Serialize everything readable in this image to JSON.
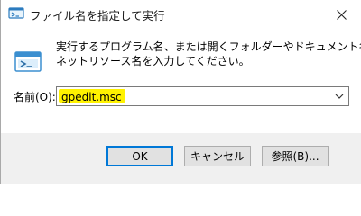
{
  "window": {
    "title": "ファイル名を指定して実行"
  },
  "dialog": {
    "description_line1": "実行するプログラム名、または開くフォルダーやドキュメント名、インター",
    "description_line2": "ネットリソース名を入力してください。",
    "open_label": "名前(O):",
    "open_value": "gpedit.msc"
  },
  "buttons": {
    "ok": "OK",
    "cancel": "キャンセル",
    "browse": "参照(B)..."
  },
  "colors": {
    "highlight": "#fff200",
    "accent": "#0078d7"
  },
  "icons": {
    "title": "run-app-icon",
    "close": "close-icon",
    "run": "run-icon",
    "dropdown": "chevron-down-icon"
  }
}
